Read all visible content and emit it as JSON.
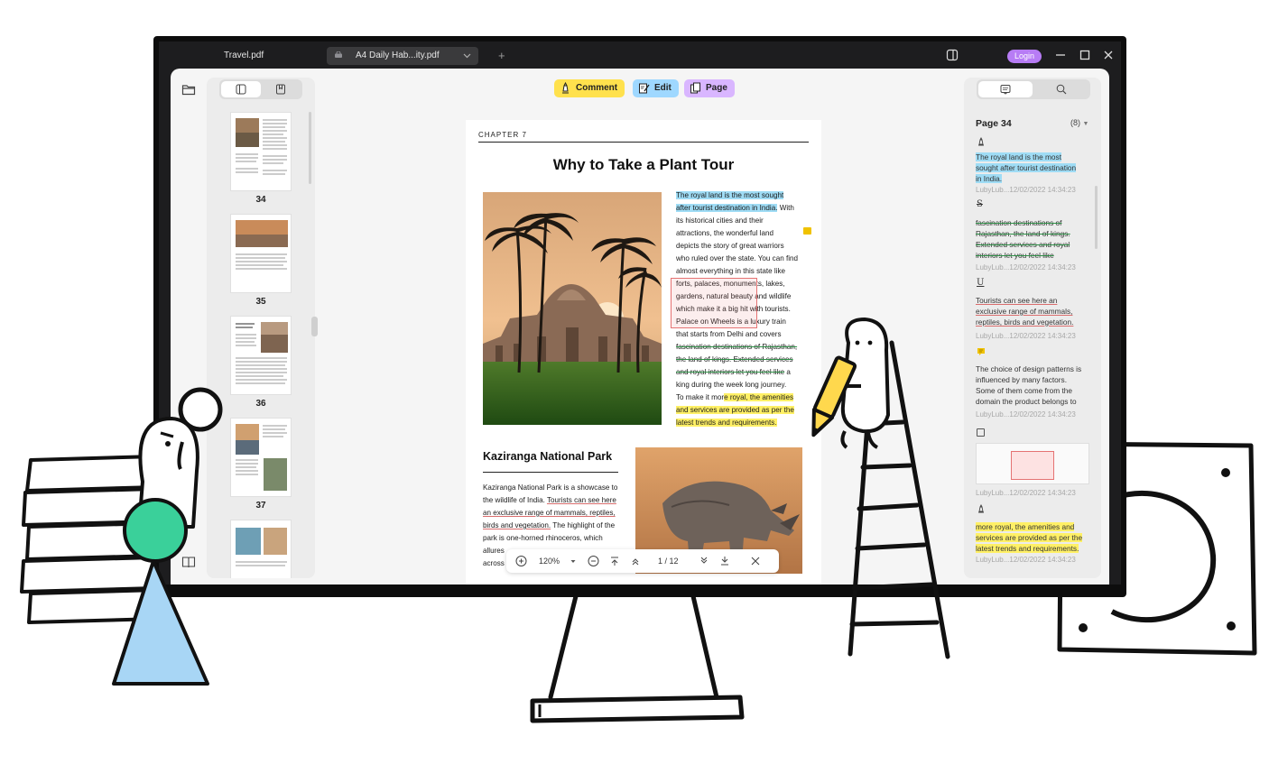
{
  "window": {
    "tabs": [
      {
        "label": "Travel.pdf",
        "active": false
      },
      {
        "label": "A4 Daily Hab...ity.pdf",
        "active": true
      }
    ],
    "login_label": "Login"
  },
  "toolbar": {
    "comment_label": "Comment",
    "edit_label": "Edit",
    "page_label": "Page"
  },
  "thumbnails": [
    {
      "page": "34"
    },
    {
      "page": "35"
    },
    {
      "page": "36"
    },
    {
      "page": "37"
    }
  ],
  "document": {
    "chapter": "CHAPTER 7",
    "title": "Why to Take a Plant Tour",
    "body_lines": [
      "The royal land is the most sought",
      "after tourist destination in India.",
      " With",
      "its historical cities and their",
      "attractions, the wonderful land",
      "depicts the story of great warriors",
      "who ruled over the state. You can find",
      "almost everything in this state like",
      "forts, palaces, monuments, lakes,",
      "gardens, natural beauty and wildlife",
      "which make it a big hit with tourists.",
      "Palace on Wheels is a luxury train",
      "that starts from Delhi and covers",
      "fascination destinations of Rajasthan,",
      "the land of kings. Extended services",
      "and royal interiors let you feel like",
      " a",
      "king during the week long journey.",
      "To make it mor",
      "e royal, the amenities",
      "and services are provided as per the",
      "latest trends and requirements."
    ],
    "section_title": "Kaziranga National Park",
    "section_lines": [
      "Kaziranga National Park is a showcase to",
      "the wildlife of India. ",
      "Tourists can see here",
      "an exclusive range of mammals, reptiles,",
      "birds and vegetation.",
      " The highlight of the",
      "park is one-horned rhinoceros, which",
      "allures",
      "across"
    ]
  },
  "zoombar": {
    "zoom": "120%",
    "page_indicator": "1 / 12"
  },
  "annotations": {
    "page_label": "Page 34",
    "count": "(8)",
    "items": [
      {
        "type": "highlight",
        "lines": [
          "The royal land is the most",
          "sought after tourist destination",
          "in India."
        ],
        "meta": "LubyLub...12/02/2022 14:34:23"
      },
      {
        "type": "strikethrough",
        "lines": [
          "fascination destinations of",
          "Rajasthan, the land of kings.",
          "Extended services and royal",
          "interiors let you feel like"
        ],
        "meta": "LubyLub...12/02/2022 14:34:23"
      },
      {
        "type": "underline",
        "lines": [
          "Tourists can see here an",
          "exclusive range of mammals,",
          "reptiles, birds and vegetation."
        ],
        "meta": "LubyLub...12/02/2022 14:34:23"
      },
      {
        "type": "note",
        "lines": [
          "The choice of design patterns is",
          "influenced by many factors.",
          "Some of them come from the",
          "domain the product belongs to"
        ],
        "meta": "LubyLub...12/02/2022 14:34:23"
      },
      {
        "type": "shape",
        "lines": [],
        "meta": "LubyLub...12/02/2022 14:34:23"
      },
      {
        "type": "highlight",
        "lines": [
          "more royal, the amenities and",
          "services are provided as per the",
          "latest trends and requirements."
        ],
        "meta": "LubyLub...12/02/2022 14:34:23"
      }
    ]
  },
  "colors": {
    "comment": "#ffe14d",
    "edit": "#9fd8ff",
    "page": "#d9b6ff",
    "login": "#b77cf5",
    "highlight_blue": "#9fdcf5",
    "highlight_yellow": "#fff066",
    "strike_green": "#2f8f47",
    "underline_red": "#d96d6d"
  }
}
